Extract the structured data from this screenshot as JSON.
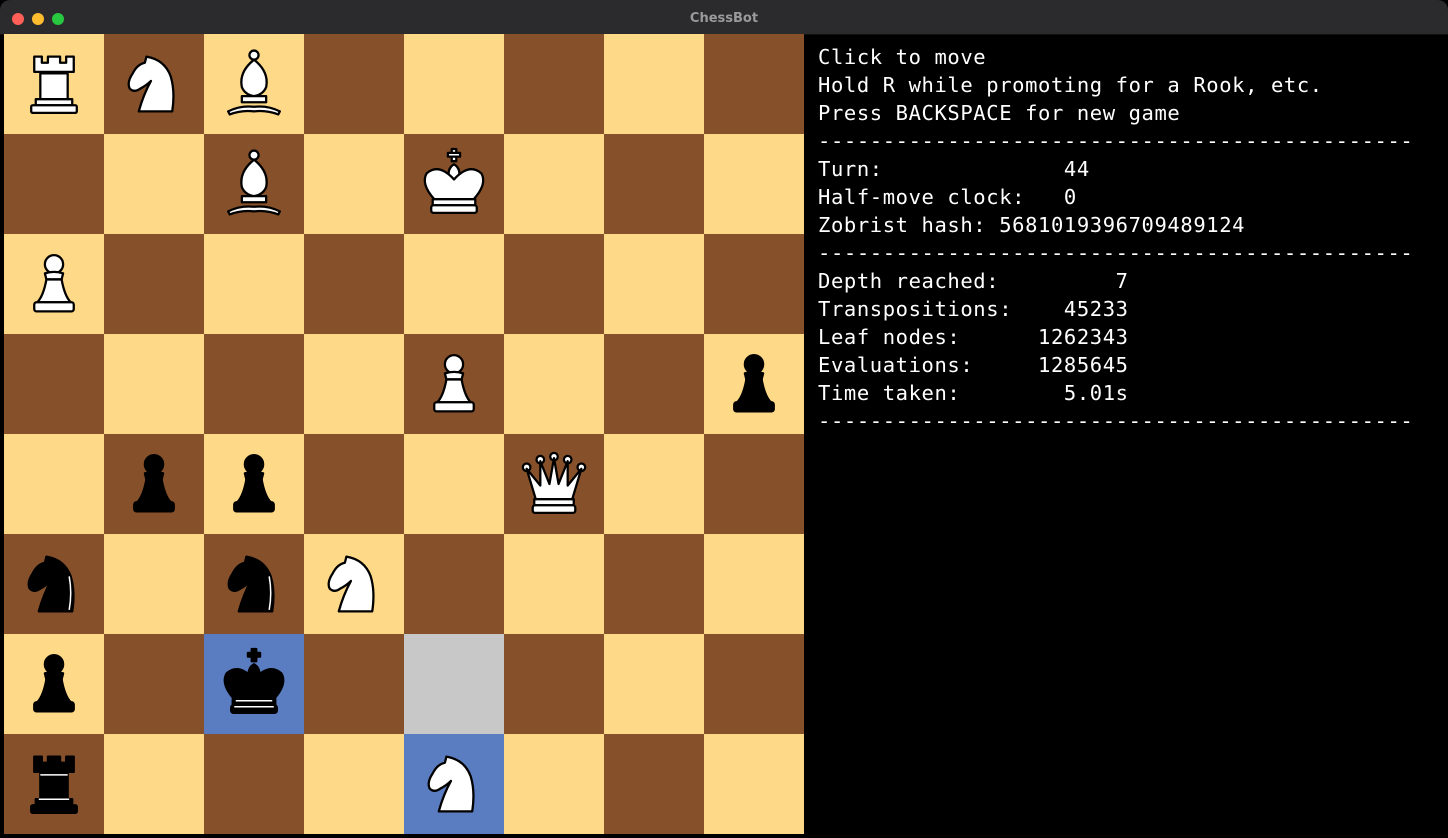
{
  "window": {
    "title": "ChessBot"
  },
  "colors": {
    "light_square": "#fed987",
    "dark_square": "#86512a",
    "last_move_highlight": "#5a7cc0",
    "selected_highlight": "#c8c8c8"
  },
  "board": {
    "ranks": [
      [
        "wR",
        "wN",
        "wB",
        "",
        "",
        "",
        "",
        ""
      ],
      [
        "",
        "",
        "wB",
        "",
        "wK",
        "",
        "",
        ""
      ],
      [
        "wP",
        "",
        "",
        "",
        "",
        "",
        "",
        ""
      ],
      [
        "",
        "",
        "",
        "",
        "wP",
        "",
        "",
        "bP"
      ],
      [
        "",
        "bP",
        "bP",
        "",
        "",
        "wQ",
        "",
        ""
      ],
      [
        "bN",
        "",
        "bN",
        "wN",
        "",
        "",
        "",
        ""
      ],
      [
        "bP",
        "",
        "bK",
        "",
        "",
        "",
        "",
        ""
      ],
      [
        "bR",
        "",
        "",
        "",
        "wN",
        "",
        "",
        ""
      ]
    ],
    "highlights": [
      {
        "row": 6,
        "col": 2,
        "kind": "last-move"
      },
      {
        "row": 7,
        "col": 4,
        "kind": "last-move"
      },
      {
        "row": 6,
        "col": 4,
        "kind": "selected"
      }
    ],
    "piece_names": {
      "wR": "white-rook",
      "wN": "white-knight",
      "wB": "white-bishop",
      "wQ": "white-queen",
      "wK": "white-king",
      "wP": "white-pawn",
      "bR": "black-rook",
      "bN": "black-knight",
      "bB": "black-bishop",
      "bQ": "black-queen",
      "bK": "black-king",
      "bP": "black-pawn"
    }
  },
  "info": {
    "instructions": [
      "Click to move",
      "Hold R while promoting for a Rook, etc.",
      "Press BACKSPACE for new game"
    ],
    "separator": "----------------------------------------------",
    "game_lines": [
      "Turn:              44",
      "Half-move clock:   0",
      "Zobrist hash: 5681019396709489124"
    ],
    "search_lines": [
      "Depth reached:         7",
      "Transpositions:    45233",
      "Leaf nodes:      1262343",
      "Evaluations:     1285645",
      "Time taken:        5.01s"
    ]
  }
}
